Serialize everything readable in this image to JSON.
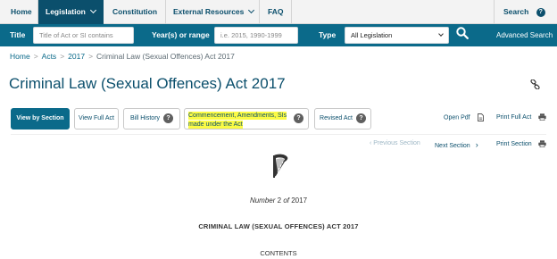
{
  "nav": {
    "home": "Home",
    "legislation": "Legislation",
    "constitution": "Constitution",
    "external_resources": "External Resources",
    "faq": "FAQ",
    "search": "Search",
    "search_help": "?"
  },
  "searchbar": {
    "title_label": "Title",
    "title_placeholder": "Title of Act or SI contains",
    "year_label": "Year(s) or range",
    "year_placeholder": "i.e. 2015, 1990-1999",
    "type_label": "Type",
    "type_value": "All Legislation",
    "advanced_search": "Advanced Search"
  },
  "breadcrumb": {
    "home": "Home",
    "acts": "Acts",
    "year": "2017",
    "current": "Criminal Law (Sexual Offences) Act 2017",
    "sep": ">"
  },
  "page_title": "Criminal Law (Sexual Offences) Act 2017",
  "buttons": {
    "view_by_section": "View by Section",
    "view_full_act": "View Full Act",
    "bill_history": "Bill History",
    "commencement_line1": "Commencement, Amendments, SIs",
    "commencement_line2": "made under the Act",
    "revised_act": "Revised Act",
    "open_pdf": "Open Pdf",
    "print_full_act": "Print Full Act",
    "help": "?"
  },
  "section_nav": {
    "previous": "Previous Section",
    "next": "Next Section",
    "print": "Print Section"
  },
  "document": {
    "number_label": "Number",
    "number_value": "2",
    "of_label": "of",
    "year": "2017",
    "act_title": "CRIMINAL LAW (SEXUAL OFFENCES) ACT 2017",
    "contents": "CONTENTS"
  },
  "colors": {
    "nav_active": "#0b4f6c",
    "search_bar": "#0b6a8a",
    "highlight": "#fbfb45",
    "link": "#0b6a8a"
  }
}
